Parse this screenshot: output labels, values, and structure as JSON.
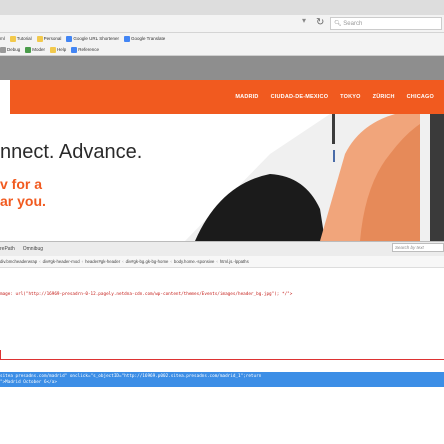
{
  "browser": {
    "search_placeholder": "Search",
    "bookmarks_row1": [
      {
        "label": "Tutorial",
        "color": "#f2c94c"
      },
      {
        "label": "Personal",
        "color": "#f2c94c"
      },
      {
        "label": "Google URL Shortener",
        "color": "#4285f4"
      },
      {
        "label": "Google Translate",
        "color": "#4285f4"
      }
    ],
    "bookmarks_row1_prefix": "ml",
    "bookmarks_row2": [
      {
        "label": "Debug",
        "color": "#999999"
      },
      {
        "label": "Moder",
        "color": "#4a9c4a"
      },
      {
        "label": "Help",
        "color": "#f2c94c"
      },
      {
        "label": "Reference",
        "color": "#4285f4"
      }
    ]
  },
  "site": {
    "nav": [
      "MADRID",
      "CIUDAD-DE-MEXICO",
      "TOKYO",
      "ZÜRICH",
      "CHICAGO"
    ],
    "hero_title": "nnect. Advance.",
    "hero_line1": "v for a",
    "hero_line2": "ar you.",
    "accent": "#f15a1f"
  },
  "devtools": {
    "tabs": [
      "rePath",
      "Omnibug"
    ],
    "search_placeholder": "Search by text",
    "breadcrumbs": [
      "div.bmcheaderwrap",
      "div#gk-header-mod",
      "header#gk-header",
      "div#gk-bg.gk-bg-home",
      "body.home.-sponsive",
      "html.js.-lppaths"
    ],
    "css_rule": "mage: url(\"http://16969-presadrn-0-12.pagely.netdna-cdn.com/wp-content/themes/Events/images/header_bg.jpg\"); */\">",
    "selected_line1": "sitea presadns.com/madrid\" onclick=\"s_objectID=\"http://16969.p002.sitea.presadns.com/madrid_1\";return",
    "selected_line2": "\">Madrid October 6</a>"
  }
}
